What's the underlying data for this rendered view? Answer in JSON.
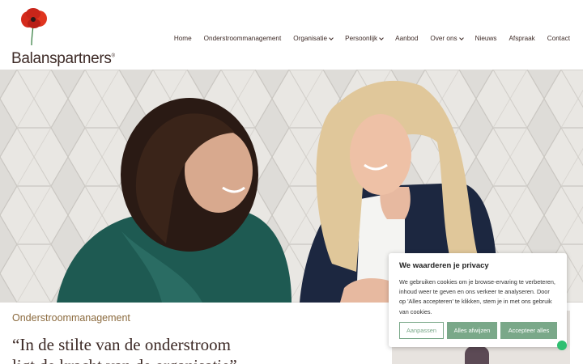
{
  "brand": {
    "name": "Balanspartners",
    "trademark": "®"
  },
  "nav": [
    {
      "label": "Home",
      "dropdown": false
    },
    {
      "label": "Onderstroommanagement",
      "dropdown": false
    },
    {
      "label": "Organisatie",
      "dropdown": true
    },
    {
      "label": "Persoonlijk",
      "dropdown": true
    },
    {
      "label": "Aanbod",
      "dropdown": false
    },
    {
      "label": "Over ons",
      "dropdown": true
    },
    {
      "label": "Nieuws",
      "dropdown": false
    },
    {
      "label": "Afspraak",
      "dropdown": false
    },
    {
      "label": "Contact",
      "dropdown": false
    }
  ],
  "content": {
    "section_label": "Onderstroommanagement",
    "quote_line1": "“In de stilte van de onderstroom",
    "quote_line2": "ligt de kracht van de organisatie”"
  },
  "cookie": {
    "title": "We waarderen je privacy",
    "text": "We gebruiken cookies om je browse-ervaring te verbeteren, inhoud weer te geven en ons verkeer te analyseren. Door op 'Alles accepteren' te klikken, stem je in met ons gebruik van cookies.",
    "customize_label": "Aanpassen",
    "reject_label": "Alles afwijzen",
    "accept_label": "Accepteer alles"
  },
  "colors": {
    "accent_green": "#7aa889",
    "brand_brown": "#3d2a26",
    "label_gold": "#8b6a3e",
    "poppy_red": "#d42a1c"
  },
  "icons": {
    "logo": "poppy-flower-icon",
    "dropdown": "chevron-down-icon",
    "chat": "whatsapp-icon"
  }
}
